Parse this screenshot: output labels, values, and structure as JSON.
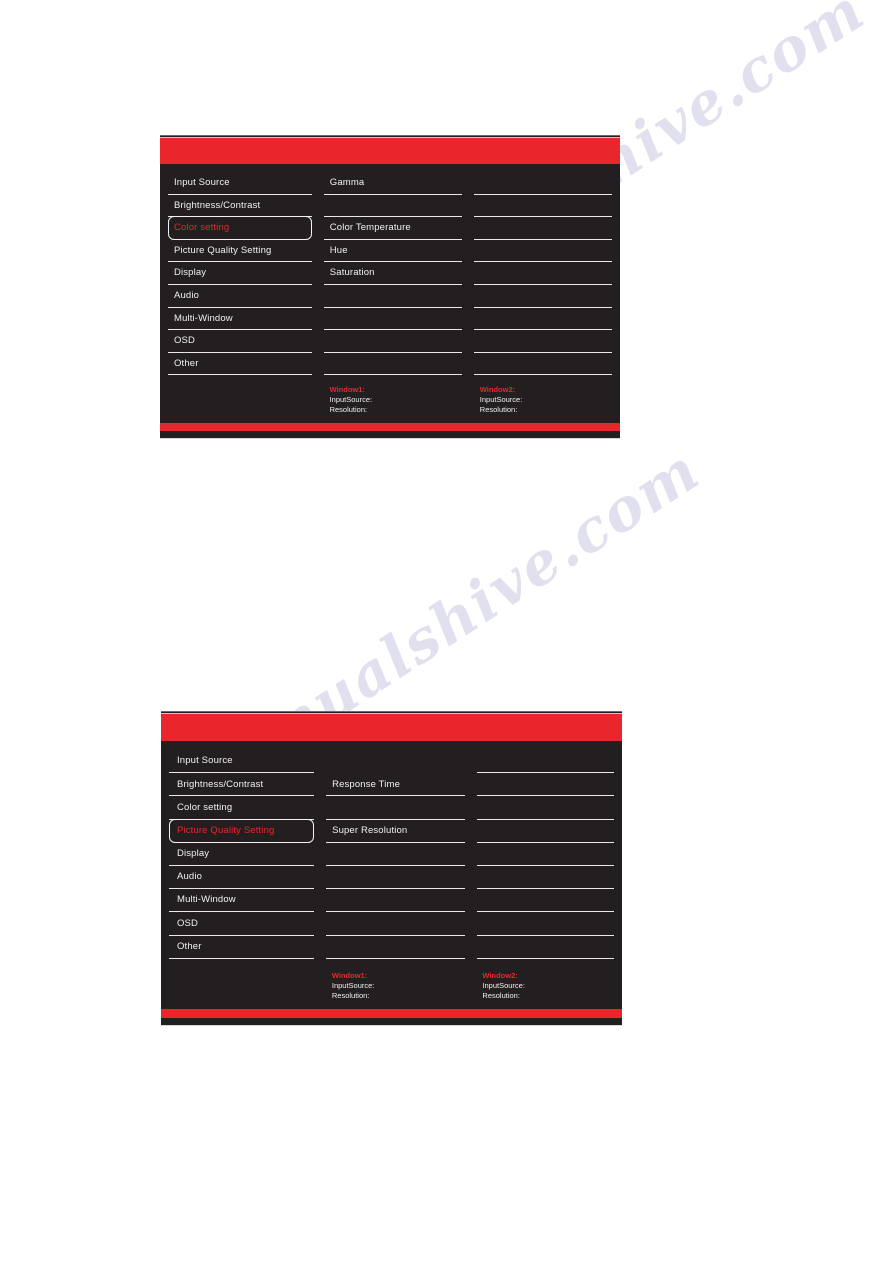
{
  "page": {
    "background": "#ffffff",
    "watermark_text": "manualshive.com",
    "watermark_text_2": "manualshive.com"
  },
  "colors": {
    "panel_background": "#231f20",
    "accent_red": "#e8262c",
    "text_white": "#f2f0f0",
    "divider": "#e9e7e8",
    "selection_border": "#f4f2f2"
  },
  "menus": [
    {
      "id": "color-setting-menu",
      "left_column": {
        "items": [
          {
            "label": "Input Source",
            "selected": false
          },
          {
            "label": "Brightness/Contrast",
            "selected": false
          },
          {
            "label": "Color setting",
            "selected": true
          },
          {
            "label": "Picture Quality Setting",
            "selected": false
          },
          {
            "label": "Display",
            "selected": false
          },
          {
            "label": "Audio",
            "selected": false
          },
          {
            "label": "Multi-Window",
            "selected": false
          },
          {
            "label": "OSD",
            "selected": false
          },
          {
            "label": "Other",
            "selected": false
          }
        ]
      },
      "middle_column": {
        "items": [
          {
            "label": "Gamma"
          },
          {
            "label": ""
          },
          {
            "label": "Color Temperature"
          },
          {
            "label": "Hue"
          },
          {
            "label": "Saturation"
          },
          {
            "label": ""
          },
          {
            "label": ""
          },
          {
            "label": ""
          },
          {
            "label": ""
          }
        ]
      },
      "right_column": {
        "items": [
          {
            "label": ""
          },
          {
            "label": ""
          },
          {
            "label": ""
          },
          {
            "label": ""
          },
          {
            "label": ""
          },
          {
            "label": ""
          },
          {
            "label": ""
          },
          {
            "label": ""
          },
          {
            "label": ""
          }
        ]
      },
      "status": {
        "window1": {
          "title": "Window1:",
          "input_source_label": "InputSource:",
          "resolution_label": "Resolution:"
        },
        "window2": {
          "title": "Window2:",
          "input_source_label": "InputSource:",
          "resolution_label": "Resolution:"
        }
      }
    },
    {
      "id": "picture-quality-setting-menu",
      "left_column": {
        "items": [
          {
            "label": "Input Source",
            "selected": false
          },
          {
            "label": "Brightness/Contrast",
            "selected": false
          },
          {
            "label": "Color setting",
            "selected": false
          },
          {
            "label": "Picture Quality Setting",
            "selected": true
          },
          {
            "label": "Display",
            "selected": false
          },
          {
            "label": "Audio",
            "selected": false
          },
          {
            "label": "Multi-Window",
            "selected": false
          },
          {
            "label": "OSD",
            "selected": false
          },
          {
            "label": "Other",
            "selected": false
          }
        ]
      },
      "middle_column": {
        "items": [
          {
            "label": ""
          },
          {
            "label": "Response Time"
          },
          {
            "label": ""
          },
          {
            "label": "Super Resolution"
          },
          {
            "label": ""
          },
          {
            "label": ""
          },
          {
            "label": ""
          },
          {
            "label": ""
          },
          {
            "label": ""
          }
        ]
      },
      "right_column": {
        "items": [
          {
            "label": ""
          },
          {
            "label": ""
          },
          {
            "label": ""
          },
          {
            "label": ""
          },
          {
            "label": ""
          },
          {
            "label": ""
          },
          {
            "label": ""
          },
          {
            "label": ""
          },
          {
            "label": ""
          }
        ]
      },
      "status": {
        "window1": {
          "title": "Window1:",
          "input_source_label": "InputSource:",
          "resolution_label": "Resolution:"
        },
        "window2": {
          "title": "Window2:",
          "input_source_label": "InputSource:",
          "resolution_label": "Resolution:"
        }
      }
    }
  ]
}
